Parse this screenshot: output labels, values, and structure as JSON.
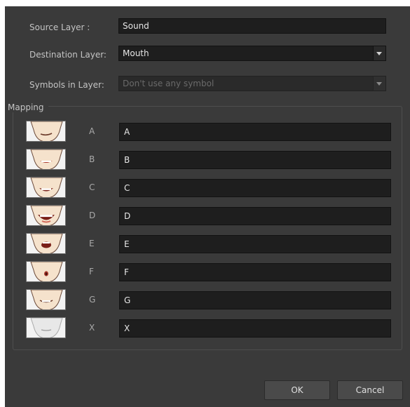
{
  "source": {
    "label": "Source Layer :",
    "value": "Sound"
  },
  "destination": {
    "label": "Destination Layer:",
    "value": "Mouth"
  },
  "symbols": {
    "label": "Symbols in Layer:",
    "value": "Don't use any symbol"
  },
  "mapping": {
    "title": "Mapping",
    "rows": [
      {
        "letter": "A",
        "value": "A",
        "mouth": "closed-smile"
      },
      {
        "letter": "B",
        "value": "B",
        "mouth": "teeth"
      },
      {
        "letter": "C",
        "value": "C",
        "mouth": "open-teeth"
      },
      {
        "letter": "D",
        "value": "D",
        "mouth": "wide-open"
      },
      {
        "letter": "E",
        "value": "E",
        "mouth": "round-open"
      },
      {
        "letter": "F",
        "value": "F",
        "mouth": "small-o"
      },
      {
        "letter": "G",
        "value": "G",
        "mouth": "lip-bite"
      },
      {
        "letter": "X",
        "value": "X",
        "mouth": "rest"
      }
    ]
  },
  "buttons": {
    "ok": "OK",
    "cancel": "Cancel"
  },
  "colors": {
    "background": "#3a3a3a",
    "field": "#1e1e1e",
    "thumb": "#f3f3f3",
    "lips": "#a8372c"
  }
}
